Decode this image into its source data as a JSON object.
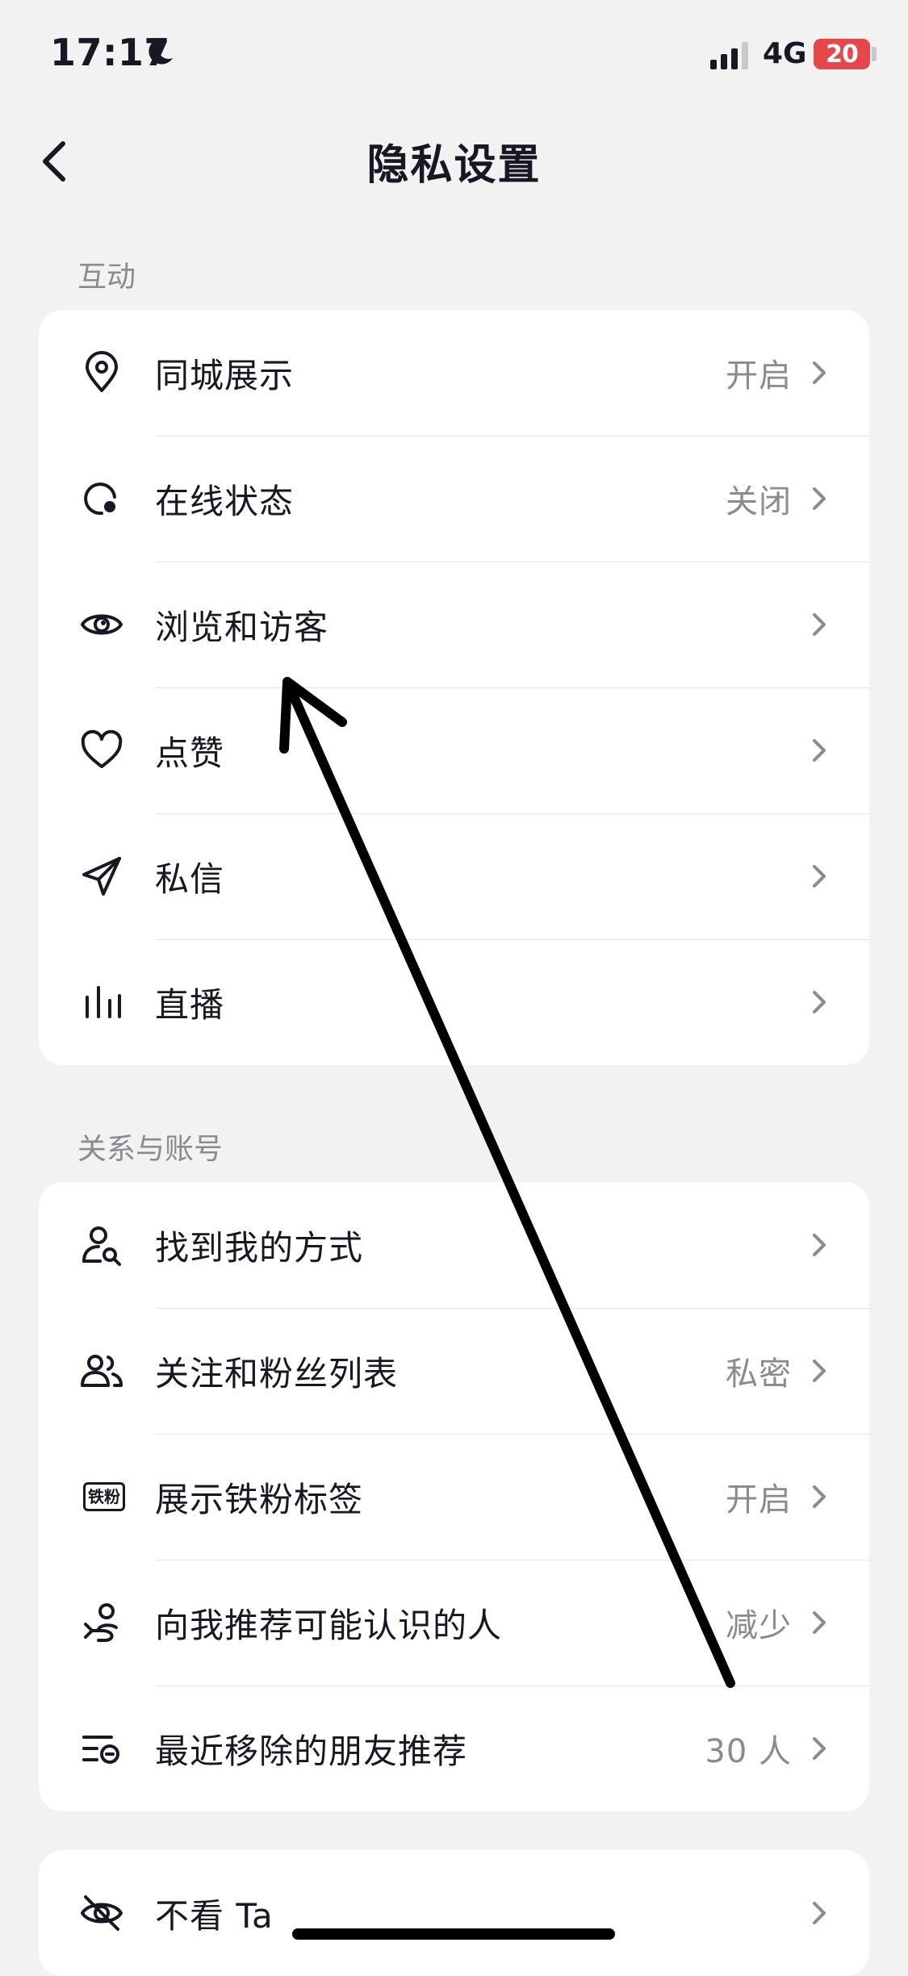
{
  "status_bar": {
    "time": "17:17",
    "network": "4G",
    "battery": "20"
  },
  "nav": {
    "title": "隐私设置"
  },
  "sections": [
    {
      "header": "互动",
      "items": [
        {
          "label": "同城展示",
          "value": "开启",
          "icon": "location-pin-icon"
        },
        {
          "label": "在线状态",
          "value": "关闭",
          "icon": "online-status-icon"
        },
        {
          "label": "浏览和访客",
          "value": "",
          "icon": "eye-icon"
        },
        {
          "label": "点赞",
          "value": "",
          "icon": "heart-icon"
        },
        {
          "label": "私信",
          "value": "",
          "icon": "paper-plane-icon"
        },
        {
          "label": "直播",
          "value": "",
          "icon": "live-bars-icon"
        }
      ]
    },
    {
      "header": "关系与账号",
      "items": [
        {
          "label": "找到我的方式",
          "value": "",
          "icon": "user-search-icon"
        },
        {
          "label": "关注和粉丝列表",
          "value": "私密",
          "icon": "users-icon"
        },
        {
          "label": "展示铁粉标签",
          "value": "开启",
          "icon": "fan-badge-icon",
          "badge_text": "铁粉"
        },
        {
          "label": "向我推荐可能认识的人",
          "value": "减少",
          "icon": "recommend-user-icon"
        },
        {
          "label": "最近移除的朋友推荐",
          "value": "30 人",
          "icon": "removed-list-icon"
        }
      ]
    },
    {
      "header": "",
      "items": [
        {
          "label": "不看 Ta",
          "value": "",
          "icon": "eye-off-icon"
        }
      ]
    }
  ],
  "colors": {
    "background": "#f2f2f2",
    "card": "#ffffff",
    "text_primary": "#161823",
    "text_secondary": "#8a8b91",
    "battery": "#e5474b"
  }
}
